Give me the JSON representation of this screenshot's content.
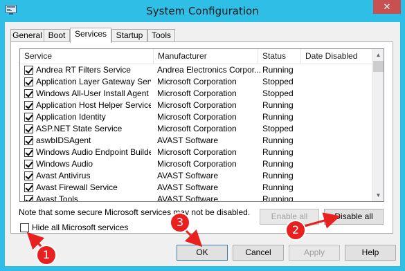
{
  "window": {
    "title": "System Configuration",
    "close_label": "✕"
  },
  "tabs": [
    {
      "label": "General"
    },
    {
      "label": "Boot"
    },
    {
      "label": "Services"
    },
    {
      "label": "Startup"
    },
    {
      "label": "Tools"
    }
  ],
  "active_tab": "Services",
  "table": {
    "columns": [
      "Service",
      "Manufacturer",
      "Status",
      "Date Disabled"
    ],
    "rows": [
      {
        "service": "Andrea RT Filters Service",
        "manufacturer": "Andrea Electronics Corpor...",
        "status": "Running",
        "checked": true
      },
      {
        "service": "Application Layer Gateway Service",
        "manufacturer": "Microsoft Corporation",
        "status": "Stopped",
        "checked": true
      },
      {
        "service": "Windows All-User Install Agent",
        "manufacturer": "Microsoft Corporation",
        "status": "Stopped",
        "checked": true
      },
      {
        "service": "Application Host Helper Service",
        "manufacturer": "Microsoft Corporation",
        "status": "Running",
        "checked": true
      },
      {
        "service": "Application Identity",
        "manufacturer": "Microsoft Corporation",
        "status": "Running",
        "checked": true
      },
      {
        "service": "ASP.NET State Service",
        "manufacturer": "Microsoft Corporation",
        "status": "Stopped",
        "checked": true
      },
      {
        "service": "aswbIDSAgent",
        "manufacturer": "AVAST Software",
        "status": "Running",
        "checked": true
      },
      {
        "service": "Windows Audio Endpoint Builder",
        "manufacturer": "Microsoft Corporation",
        "status": "Running",
        "checked": true
      },
      {
        "service": "Windows Audio",
        "manufacturer": "Microsoft Corporation",
        "status": "Running",
        "checked": true
      },
      {
        "service": "Avast Antivirus",
        "manufacturer": "AVAST Software",
        "status": "Running",
        "checked": true
      },
      {
        "service": "Avast Firewall Service",
        "manufacturer": "AVAST Software",
        "status": "Running",
        "checked": true
      },
      {
        "service": "Avast Tools",
        "manufacturer": "AVAST Software",
        "status": "Running",
        "checked": true
      }
    ]
  },
  "note": "Note that some secure Microsoft services may not be disabled.",
  "buttons": {
    "enable_all": "Enable all",
    "disable_all": "Disable all",
    "ok": "OK",
    "cancel": "Cancel",
    "apply": "Apply",
    "help": "Help"
  },
  "hide_ms": {
    "label": "Hide all Microsoft services",
    "checked": false
  },
  "callouts": [
    "1",
    "2",
    "3"
  ],
  "colors": {
    "titlebar": "#2fbfe6",
    "close_button": "#c75050",
    "callout": "#e8201f"
  }
}
